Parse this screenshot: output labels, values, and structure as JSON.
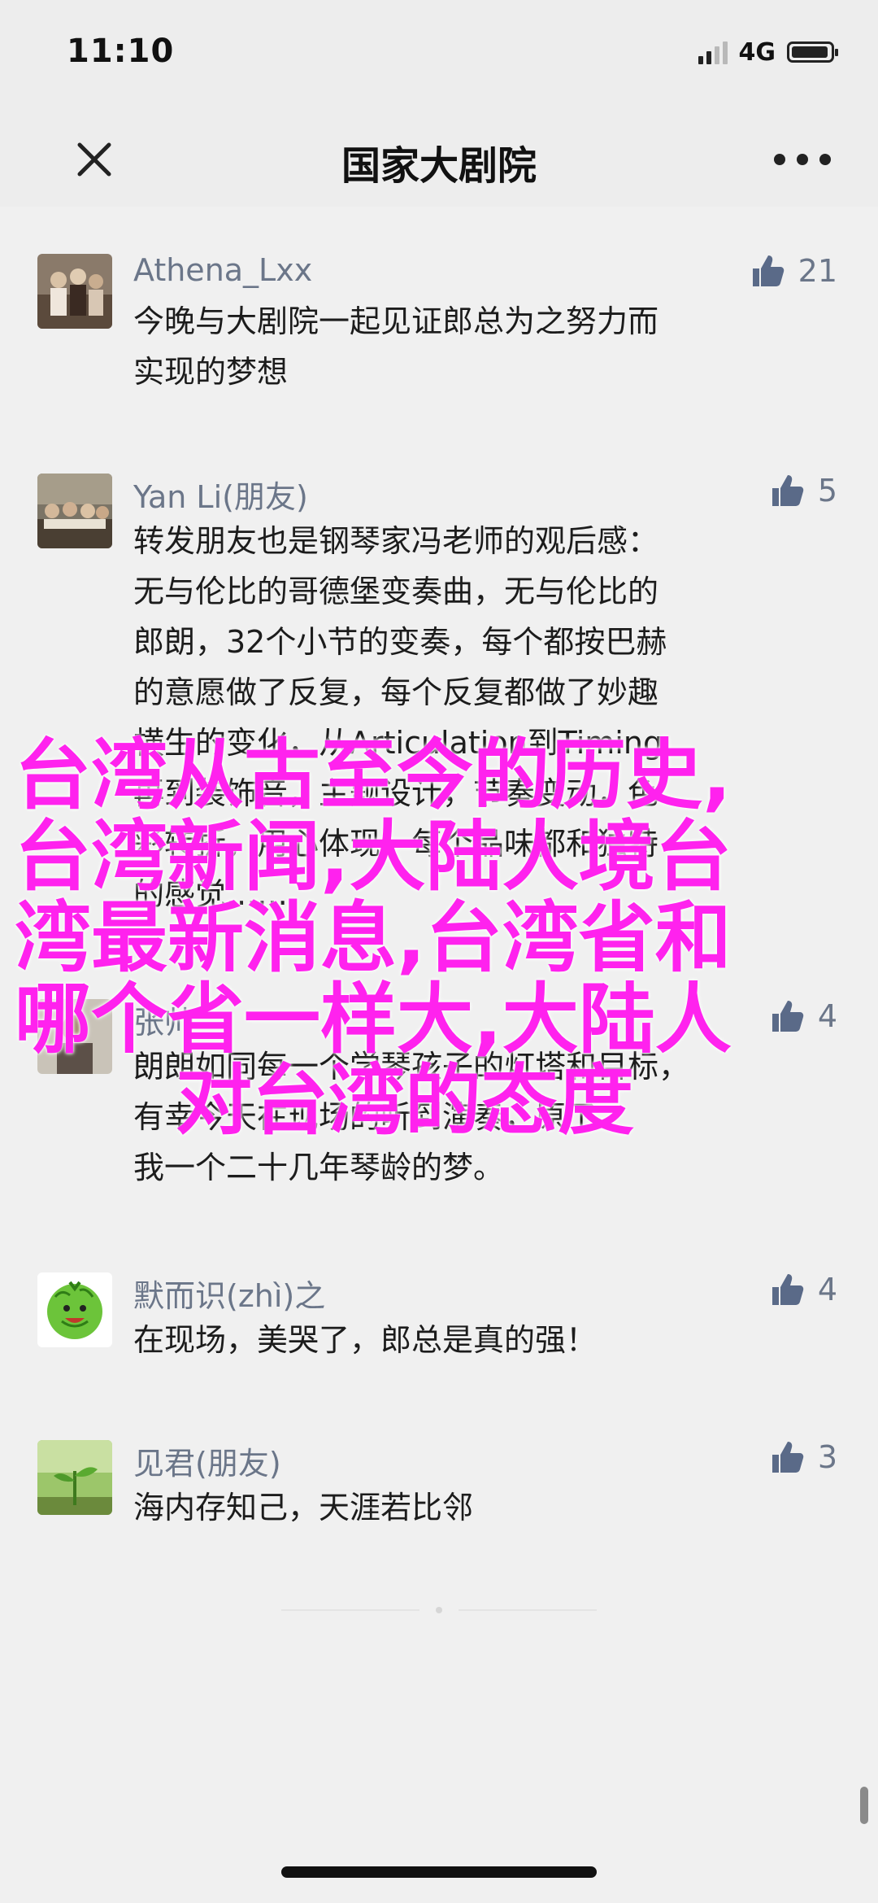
{
  "status": {
    "time": "11:10",
    "network": "4G",
    "battery_level": 0.9
  },
  "nav": {
    "title": "国家大剧院",
    "close_icon": "close-icon",
    "more_icon": "more-icon"
  },
  "comments": [
    {
      "name": "Athena_Lxx",
      "likes": "21",
      "text": "今晚与大剧院一起见证郎总为之努力而\n实现的梦想",
      "avatar_icon": "avatar-photo"
    },
    {
      "name": "Yan Li(朋友)",
      "likes": "5",
      "text": "转发朋友也是钢琴家冯老师的观后感：\n无与伦比的哥德堡变奏曲，无与伦比的\n郎朗，32个小节的变奏，每个都按巴赫\n的意愿做了反复，每个反复都做了妙趣\n横生的变化，从Articulation到Timing\n再到装饰音，主题设计，节奏变动，色\n彩转折，用心体现，每个品味都和独特\n的感觉……",
      "avatar_icon": "avatar-photo"
    },
    {
      "name": "张帅",
      "likes": "4",
      "text": "朗朗如同每一个学琴孩子的灯塔和目标，\n有幸今天在现场的听到演奏，原了\n我一个二十几年琴龄的梦。",
      "avatar_icon": "avatar-photo"
    },
    {
      "name": "默而识(zhì)之",
      "likes": "4",
      "text": "在现场，美哭了，郎总是真的强！",
      "avatar_icon": "watermelon-avatar"
    },
    {
      "name": "见君(朋友)",
      "likes": "3",
      "text": "海内存知己，天涯若比邻",
      "avatar_icon": "plant-avatar"
    }
  ],
  "overlay": {
    "lines": [
      "台湾从古至今的历史,",
      "台湾新闻,大陆人境台",
      "湾最新消息,台湾省和",
      "哪个省一样大,大陆人",
      "对台湾的态度"
    ]
  },
  "colors": {
    "overlay": "#ff22ee",
    "name": "#6b7689",
    "background": "#f0f0f0"
  }
}
